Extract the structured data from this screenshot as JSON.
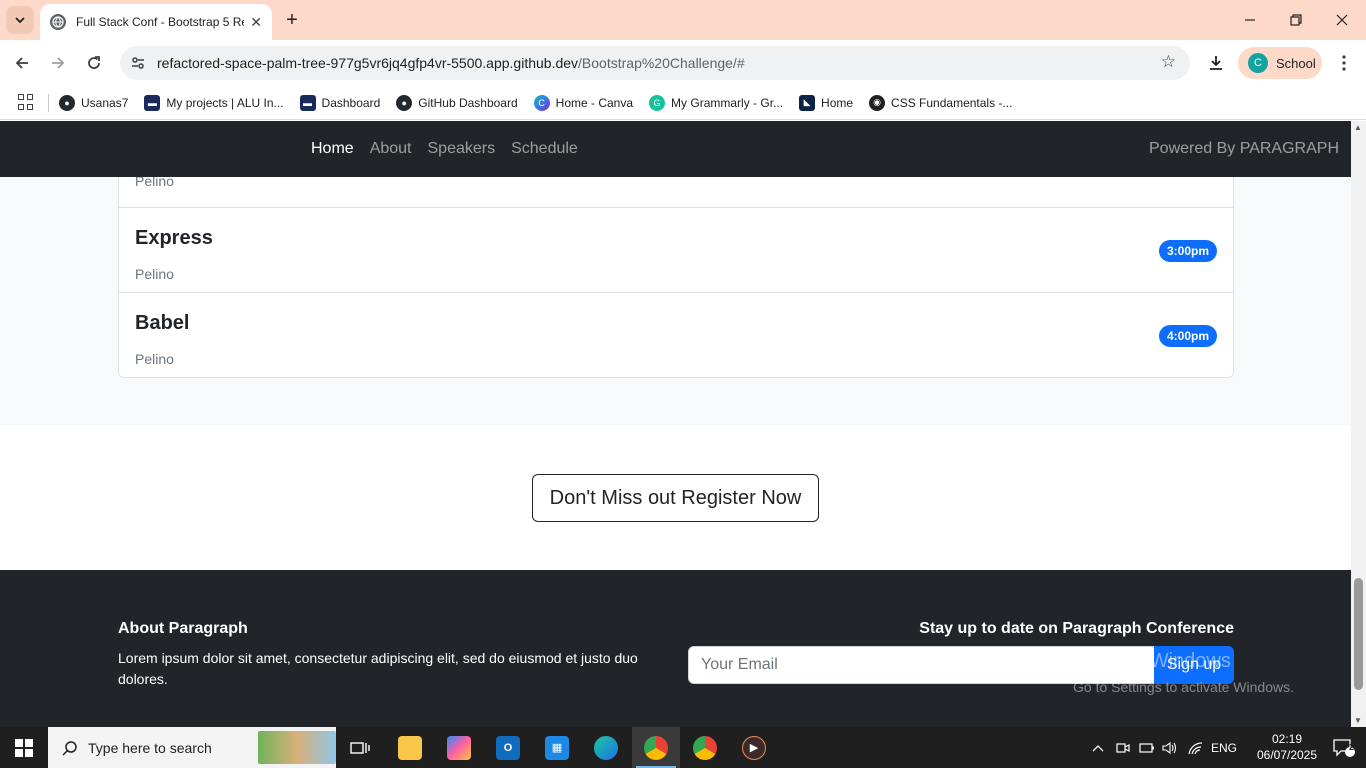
{
  "browser": {
    "tab_title": "Full Stack Conf - Bootstrap 5 Re",
    "url_host": "refactored-space-palm-tree-977g5vr6jq4gfp4vr-5500.app.github.dev",
    "url_path": "/Bootstrap%20Challenge/#",
    "profile_initial": "C",
    "profile_name": "School",
    "bookmarks": [
      {
        "label": "Usanas7",
        "icon": "github-icon"
      },
      {
        "label": "My projects | ALU In...",
        "icon": "alu-icon"
      },
      {
        "label": "Dashboard",
        "icon": "alu-icon"
      },
      {
        "label": "GitHub Dashboard",
        "icon": "github-icon"
      },
      {
        "label": "Home - Canva",
        "icon": "canva-icon"
      },
      {
        "label": "My Grammarly - Gr...",
        "icon": "grammarly-icon"
      },
      {
        "label": "Home",
        "icon": "bookmark-icon"
      },
      {
        "label": "CSS Fundamentals -...",
        "icon": "globe-icon"
      }
    ]
  },
  "site": {
    "nav": {
      "links": [
        "Home",
        "About",
        "Speakers",
        "Schedule"
      ],
      "active": "Home",
      "powered": "Powered By PARAGRAPH"
    },
    "schedule": {
      "partial_item_speaker": "Pelino",
      "items": [
        {
          "name": "Express",
          "speaker": "Pelino",
          "time": "3:00pm"
        },
        {
          "name": "Babel",
          "speaker": "Pelino",
          "time": "4:00pm"
        }
      ]
    },
    "register_button": "Don't Miss out Register Now",
    "footer": {
      "about_heading": "About Paragraph",
      "about_text": "Lorem ipsum dolor sit amet, consectetur adipiscing elit, sed do eiusmod et justo duo dolores.",
      "stay_heading": "Stay up to date on Paragraph Conference",
      "email_placeholder": "Your Email",
      "signup_label": "Sign up"
    }
  },
  "watermark": {
    "line1": "Activate Windows",
    "line2": "Go to Settings to activate Windows."
  },
  "taskbar": {
    "search_placeholder": "Type here to search",
    "lang": "ENG",
    "time": "02:19",
    "date": "06/07/2025",
    "notifications": "2"
  },
  "colors": {
    "tabbar": "#fcd9c8",
    "site_dark": "#212529",
    "primary": "#0d6efd",
    "section_bg": "#f8f9fa"
  }
}
